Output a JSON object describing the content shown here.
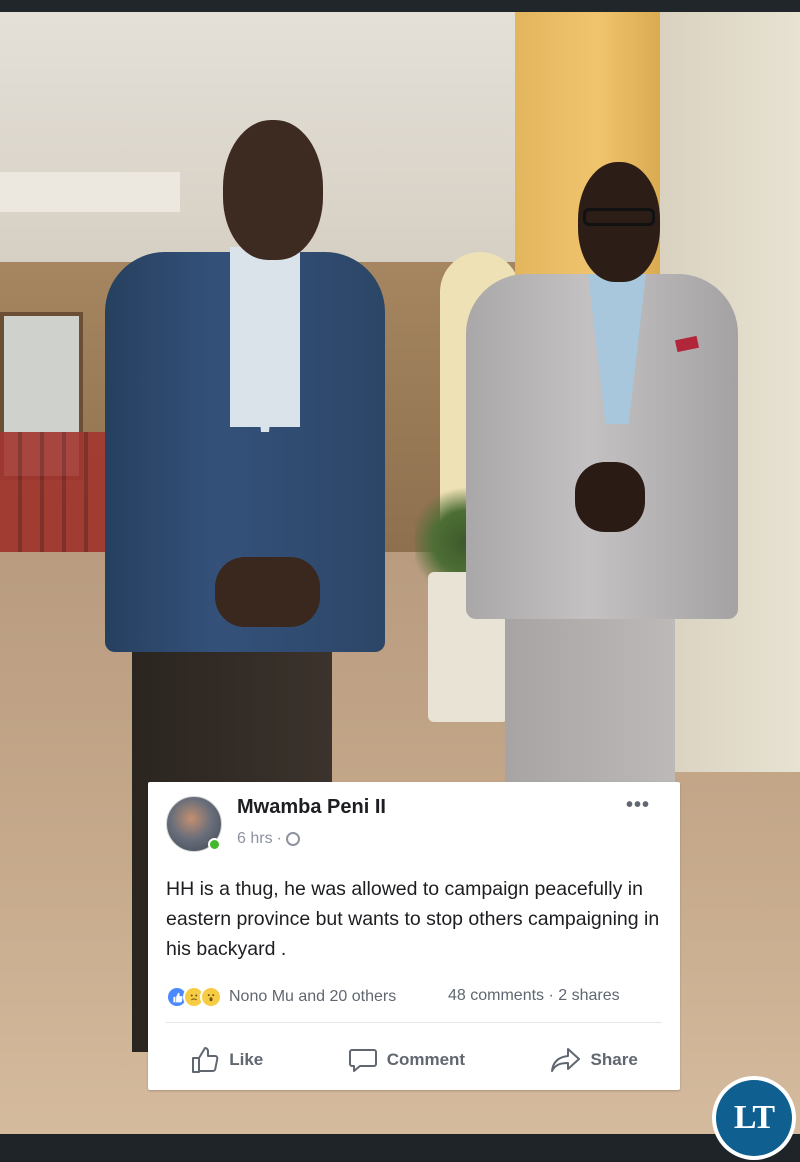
{
  "post": {
    "author": "Mwamba Peni II",
    "time": "6 hrs",
    "separator": "·",
    "more": "•••",
    "text": "HH is a thug, he was allowed to campaign peacefully in eastern province but wants to stop others campaigning in his backyard .",
    "reactions": {
      "icons": [
        "like-reaction",
        "sad-reaction",
        "wow-reaction"
      ],
      "names": "Nono Mu and 20 others",
      "comments": "48 comments",
      "dot": "·",
      "shares": "2 shares"
    },
    "actions": {
      "like": "Like",
      "comment": "Comment",
      "share": "Share"
    }
  },
  "logo": {
    "text": "LT",
    "color": "#0f5f91"
  },
  "colors": {
    "like_blue": "#4a89ff",
    "online_green": "#42b72a"
  }
}
